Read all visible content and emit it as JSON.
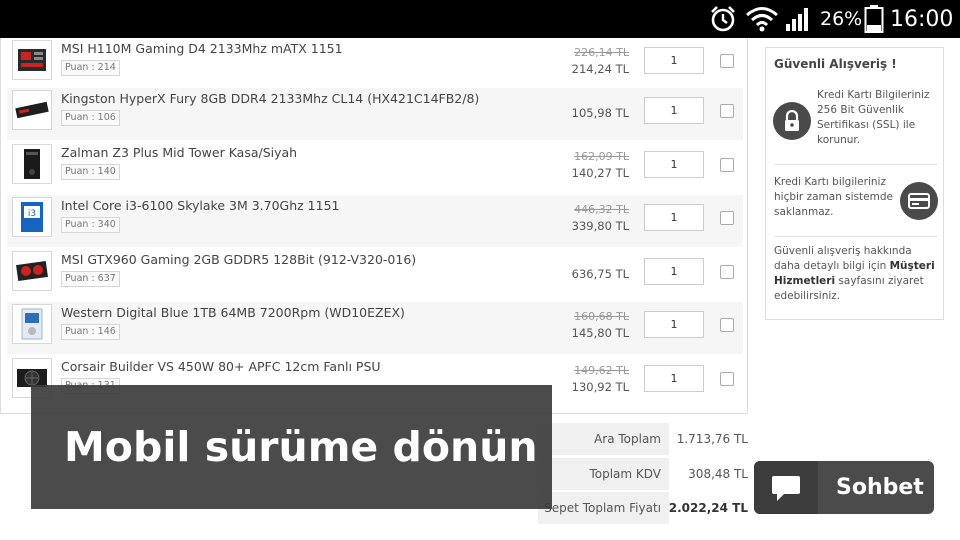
{
  "status_bar": {
    "battery": "26%",
    "time": "16:00",
    "icons": [
      "alarm-clock-icon",
      "wifi-icon",
      "cell-signal-icon",
      "battery-icon"
    ]
  },
  "cart": {
    "items": [
      {
        "name": "MSI H110M Gaming D4 2133Mhz mATX 1151",
        "puan": "Puan : 214",
        "old_price": "226,14 TL",
        "price": "214,24 TL",
        "qty": "1",
        "icon": "motherboard-icon"
      },
      {
        "name": "Kingston HyperX Fury 8GB DDR4 2133Mhz CL14 (HX421C14FB2/8)",
        "puan": "Puan : 106",
        "old_price": "",
        "price": "105,98 TL",
        "qty": "1",
        "icon": "ram-icon"
      },
      {
        "name": "Zalman Z3 Plus Mid Tower Kasa/Siyah",
        "puan": "Puan : 140",
        "old_price": "162,09 TL",
        "price": "140,27 TL",
        "qty": "1",
        "icon": "pc-case-icon"
      },
      {
        "name": "Intel Core i3-6100 Skylake 3M 3.70Ghz 1151",
        "puan": "Puan : 340",
        "old_price": "446,32 TL",
        "price": "339,80 TL",
        "qty": "1",
        "icon": "cpu-box-icon"
      },
      {
        "name": "MSI GTX960 Gaming 2GB GDDR5 128Bit (912-V320-016)",
        "puan": "Puan : 637",
        "old_price": "",
        "price": "636,75 TL",
        "qty": "1",
        "icon": "graphics-card-icon"
      },
      {
        "name": "Western Digital Blue 1TB 64MB 7200Rpm (WD10EZEX)",
        "puan": "Puan : 146",
        "old_price": "160,68 TL",
        "price": "145,80 TL",
        "qty": "1",
        "icon": "hard-drive-icon"
      },
      {
        "name": "Corsair Builder VS 450W 80+ APFC 12cm Fanlı PSU",
        "puan": "Puan : 131",
        "old_price": "149,62 TL",
        "price": "130,92 TL",
        "qty": "1",
        "icon": "power-supply-icon"
      }
    ]
  },
  "secure_box": {
    "title": "Güvenli Alışveriş !",
    "ssl_text": "Kredi Kartı Bilgileriniz 256 Bit Güvenlik Sertifikası (SSL) ile korunur.",
    "card_text": "Kredi Kartı bilgileriniz hiçbir zaman sistemde saklanmaz.",
    "info_text_before": "Güvenli alışveriş hakkında daha detaylı bilgi için ",
    "info_link": "Müşteri Hizmetleri",
    "info_text_after": " sayfasını ziyaret edebilirsiniz."
  },
  "totals": [
    {
      "label": "Ara Toplam",
      "value": "1.713,76 TL"
    },
    {
      "label": "Toplam KDV",
      "value": "308,48 TL"
    },
    {
      "label": "Sepet Toplam Fiyatı",
      "value": "2.022,24 TL"
    }
  ],
  "mobile_banner": {
    "label": "Mobil sürüme dönün"
  },
  "chat": {
    "label": "Sohbet"
  }
}
